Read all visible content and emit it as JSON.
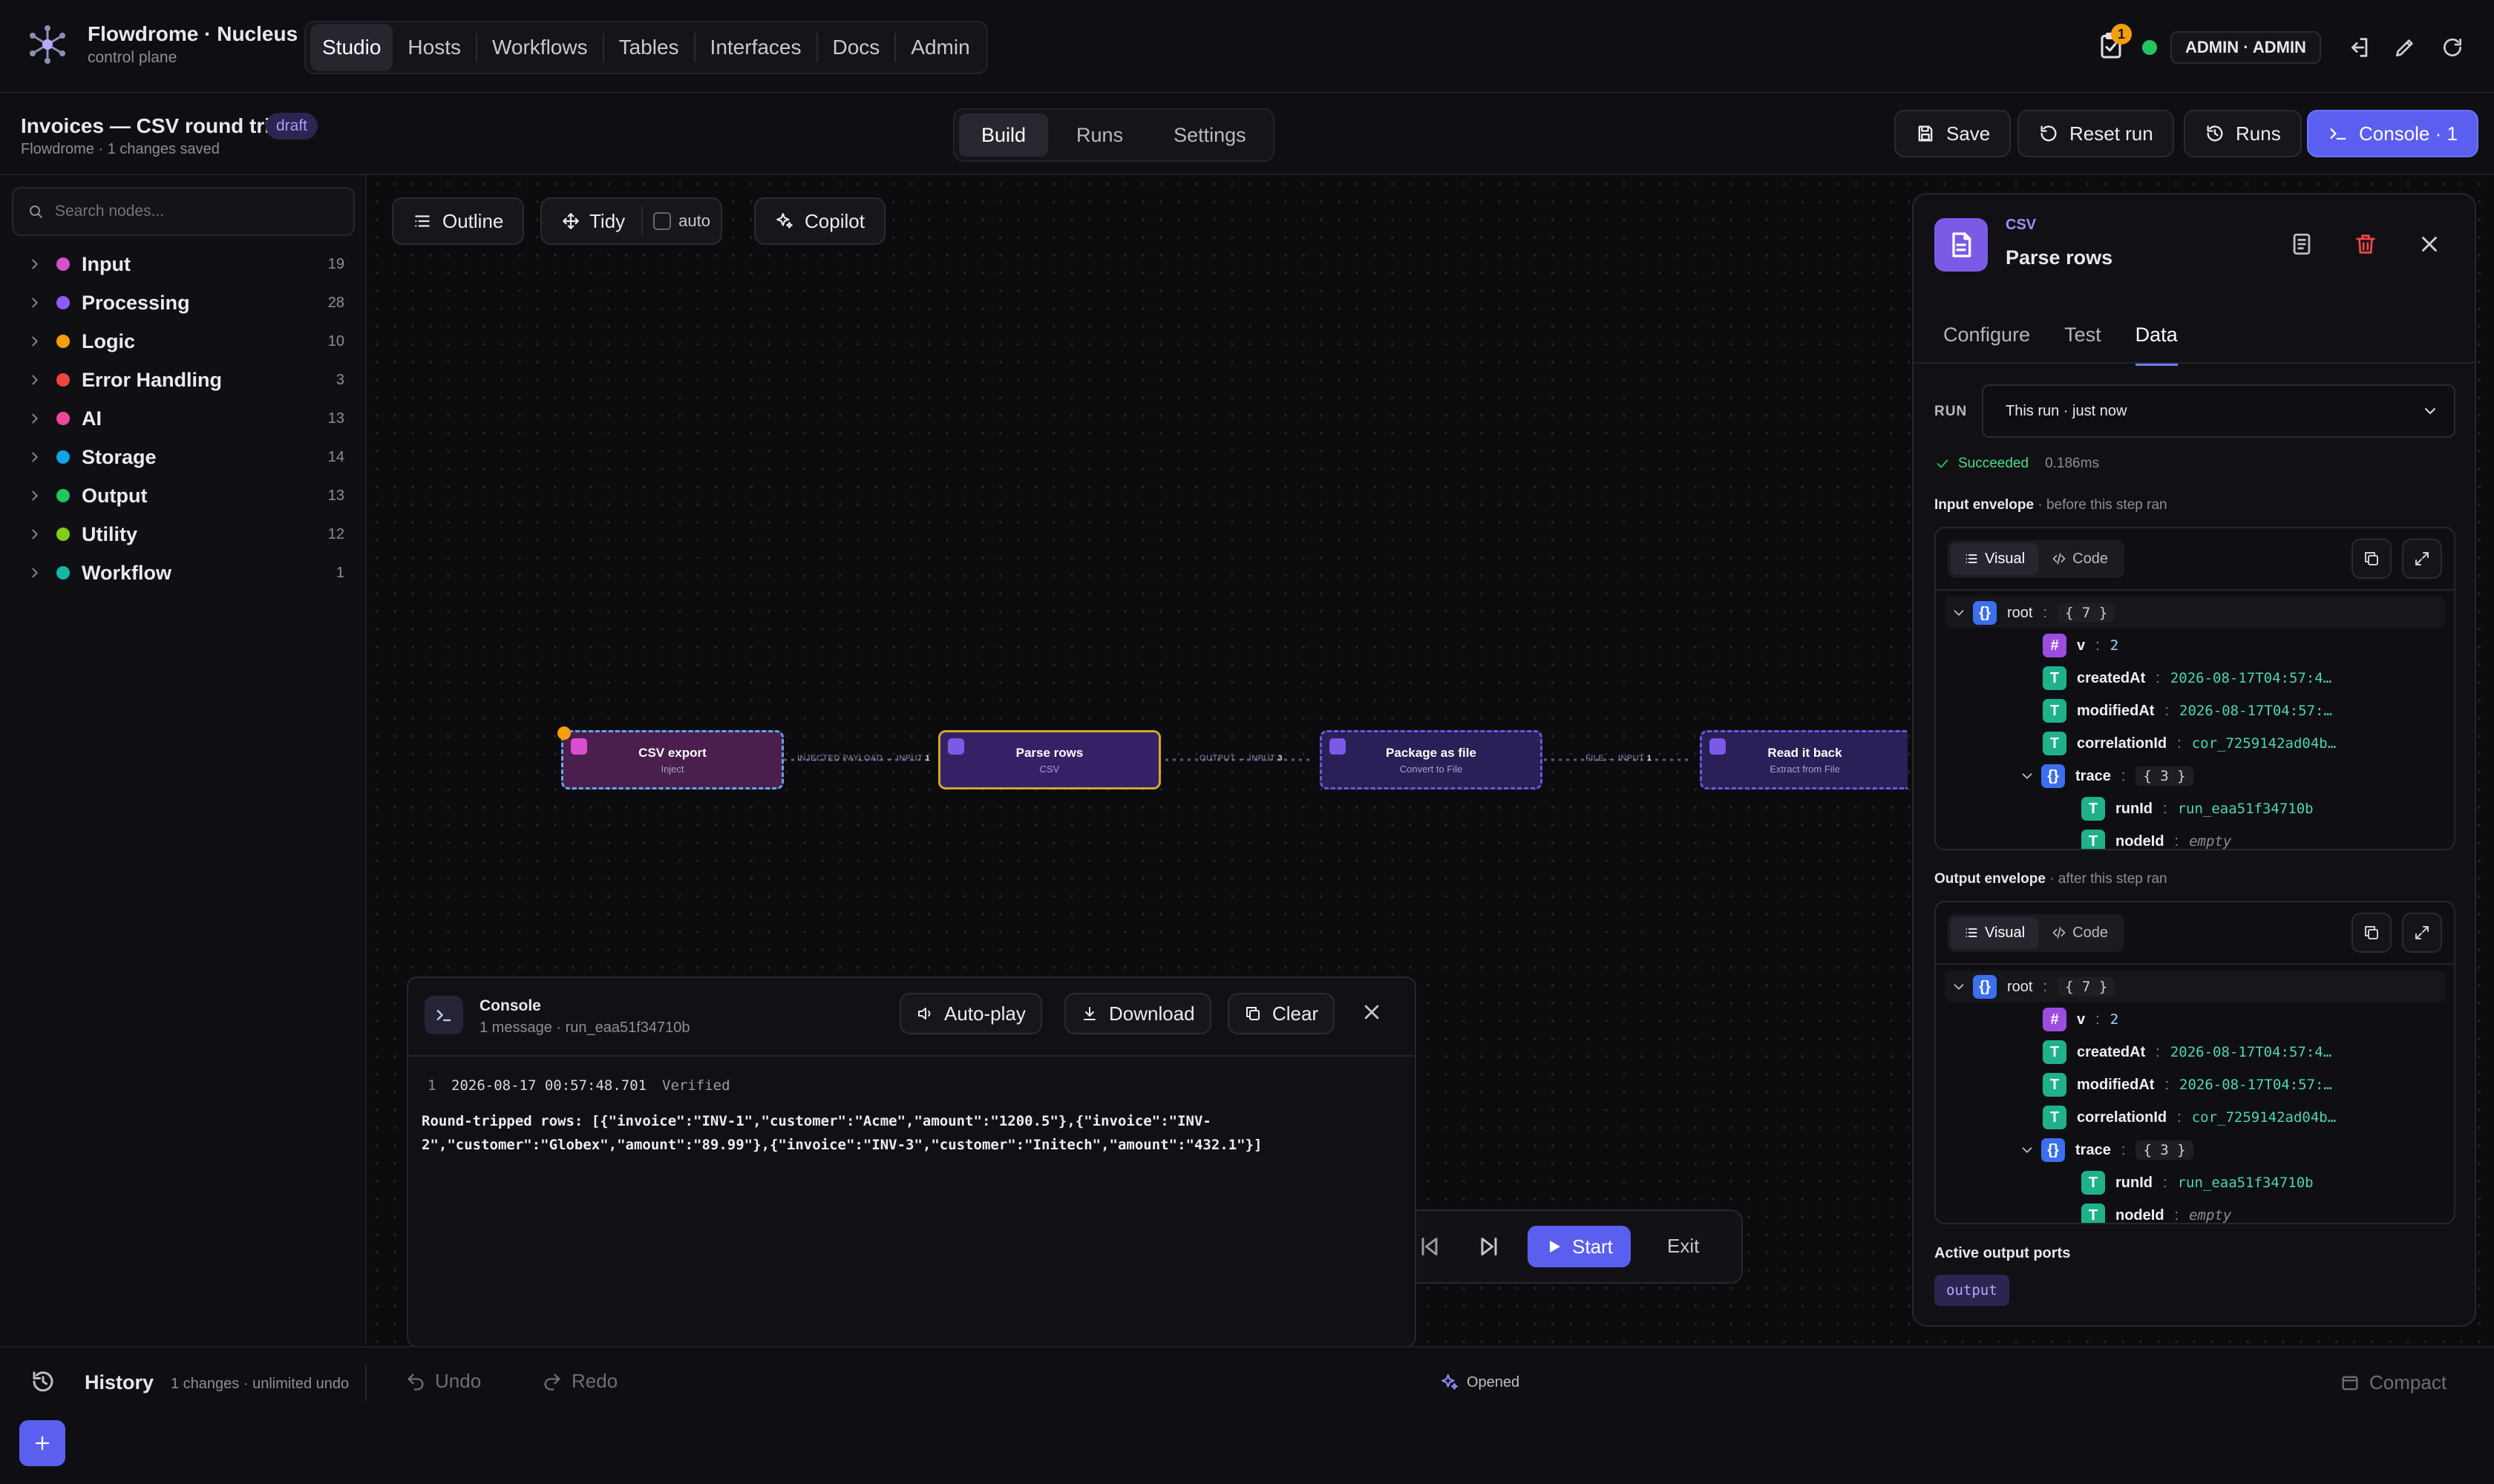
{
  "app": {
    "name": "Flowdrome · Nucleus",
    "subtitle": "control plane"
  },
  "nav": {
    "tabs": [
      "Studio",
      "Hosts",
      "Workflows",
      "Tables",
      "Interfaces",
      "Docs",
      "Admin"
    ],
    "active": "Studio"
  },
  "topright": {
    "notif_count": "1",
    "user": "ADMIN · ADMIN"
  },
  "workflow": {
    "title": "Invoices — CSV round trip",
    "badge": "draft",
    "meta": "Flowdrome · 1 changes saved"
  },
  "modes": {
    "tabs": [
      "Build",
      "Runs",
      "Settings"
    ],
    "active": "Build"
  },
  "actions": {
    "save": "Save",
    "reset": "Reset run",
    "runs": "Runs",
    "console": "Console · 1"
  },
  "sidebar": {
    "search_placeholder": "Search nodes...",
    "categories": [
      {
        "label": "Input",
        "count": "19",
        "color": "#d94fd0"
      },
      {
        "label": "Processing",
        "count": "28",
        "color": "#8b5cf6"
      },
      {
        "label": "Logic",
        "count": "10",
        "color": "#f59e0b"
      },
      {
        "label": "Error Handling",
        "count": "3",
        "color": "#ef4444"
      },
      {
        "label": "AI",
        "count": "13",
        "color": "#ec4899"
      },
      {
        "label": "Storage",
        "count": "14",
        "color": "#0ea5e9"
      },
      {
        "label": "Output",
        "count": "13",
        "color": "#22c55e"
      },
      {
        "label": "Utility",
        "count": "12",
        "color": "#84cc16"
      },
      {
        "label": "Workflow",
        "count": "1",
        "color": "#14b8a6"
      }
    ]
  },
  "toolbar": {
    "outline": "Outline",
    "tidy": "Tidy",
    "auto": "auto",
    "copilot": "Copilot"
  },
  "nodes": [
    {
      "title": "CSV export",
      "sub": "Inject"
    },
    {
      "title": "Parse rows",
      "sub": "CSV"
    },
    {
      "title": "Package as file",
      "sub": "Convert to File"
    },
    {
      "title": "Read it back",
      "sub": "Extract from File"
    }
  ],
  "edges": [
    {
      "label": "INJECTED PAYLOAD → INPUT",
      "count": "1"
    },
    {
      "label": "OUTPUT → INPUT",
      "count": "3"
    },
    {
      "label": "FILE → INPUT",
      "count": "1"
    }
  ],
  "console": {
    "title": "Console",
    "meta": "1 message · run_eaa51f34710b",
    "autoplay": "Auto-play",
    "download": "Download",
    "clear": "Clear",
    "line_no": "1",
    "timestamp": "2026-08-17 00:57:48.701",
    "status": "Verified",
    "message_l1": "Round-tripped rows: [{\"invoice\":\"INV-1\",\"customer\":\"Acme\",\"amount\":\"1200.5\"},{\"invoice\":\"INV-",
    "message_l2": "2\",\"customer\":\"Globex\",\"amount\":\"89.99\"},{\"invoice\":\"INV-3\",\"customer\":\"Initech\",\"amount\":\"432.1\"}]"
  },
  "playback": {
    "start": "Start",
    "exit": "Exit"
  },
  "panel": {
    "kind": "CSV",
    "title": "Parse rows",
    "tabs": [
      "Configure",
      "Test",
      "Data"
    ],
    "active_tab": "Data",
    "run_label": "RUN",
    "run_value": "This run · just now",
    "status": "Succeeded",
    "duration": "0.186ms",
    "input_title": "Input envelope",
    "input_sub": "· before this step ran",
    "output_title": "Output envelope",
    "output_sub": "· after this step ran",
    "visual": "Visual",
    "code": "Code",
    "tree": {
      "root": "root",
      "root_count": "{ 7 }",
      "v_key": "v",
      "v_val": "2",
      "created_key": "createdAt",
      "created_val": "2026-08-17T04:57:4…",
      "modified_key": "modifiedAt",
      "modified_val": "2026-08-17T04:57:…",
      "corr_key": "correlationId",
      "corr_val": "cor_7259142ad04b…",
      "trace_key": "trace",
      "trace_count": "{ 3 }",
      "runid_key": "runId",
      "runid_val": "run_eaa51f34710b",
      "nodeid_key": "nodeId",
      "nodeid_val": "empty"
    },
    "ports_title": "Active output ports",
    "port": "output"
  },
  "footer": {
    "history": "History",
    "history_meta": "1 changes · unlimited undo",
    "undo": "Undo",
    "redo": "Redo",
    "status": "Opened",
    "compact": "Compact"
  }
}
